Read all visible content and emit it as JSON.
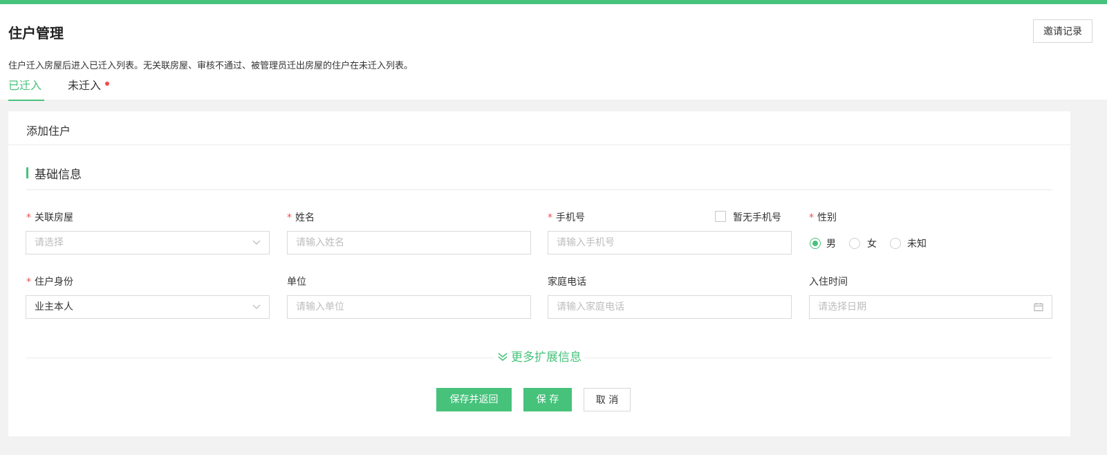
{
  "header": {
    "title": "住户管理",
    "invite_button": "邀请记录",
    "description": "住户迁入房屋后进入已迁入列表。无关联房屋、审核不通过、被管理员迁出房屋的住户在未迁入列表。"
  },
  "tabs": [
    {
      "label": "已迁入",
      "active": true
    },
    {
      "label": "未迁入",
      "active": false,
      "has_dot": true
    }
  ],
  "panel": {
    "title": "添加住户",
    "section_title": "基础信息"
  },
  "form": {
    "house": {
      "label": "关联房屋",
      "required": true,
      "placeholder": "请选择"
    },
    "name": {
      "label": "姓名",
      "required": true,
      "placeholder": "请输入姓名"
    },
    "phone": {
      "label": "手机号",
      "required": true,
      "placeholder": "请输入手机号",
      "no_phone_label": "暂无手机号"
    },
    "gender": {
      "label": "性别",
      "required": true,
      "options": [
        "男",
        "女",
        "未知"
      ],
      "selected": "男"
    },
    "identity": {
      "label": "住户身份",
      "required": true,
      "value": "业主本人"
    },
    "company": {
      "label": "单位",
      "required": false,
      "placeholder": "请输入单位"
    },
    "home_phone": {
      "label": "家庭电话",
      "required": false,
      "placeholder": "请输入家庭电话"
    },
    "move_in_date": {
      "label": "入住时间",
      "required": false,
      "placeholder": "请选择日期"
    }
  },
  "more_info_label": "更多扩展信息",
  "actions": {
    "save_and_return": "保存并返回",
    "save": "保 存",
    "cancel": "取 消"
  },
  "colors": {
    "accent": "#46c27b",
    "required": "#f04d4d",
    "placeholder": "#bdbdbd"
  },
  "icons": [
    "chevron-down-icon",
    "calendar-icon",
    "double-chevron-down-icon"
  ]
}
